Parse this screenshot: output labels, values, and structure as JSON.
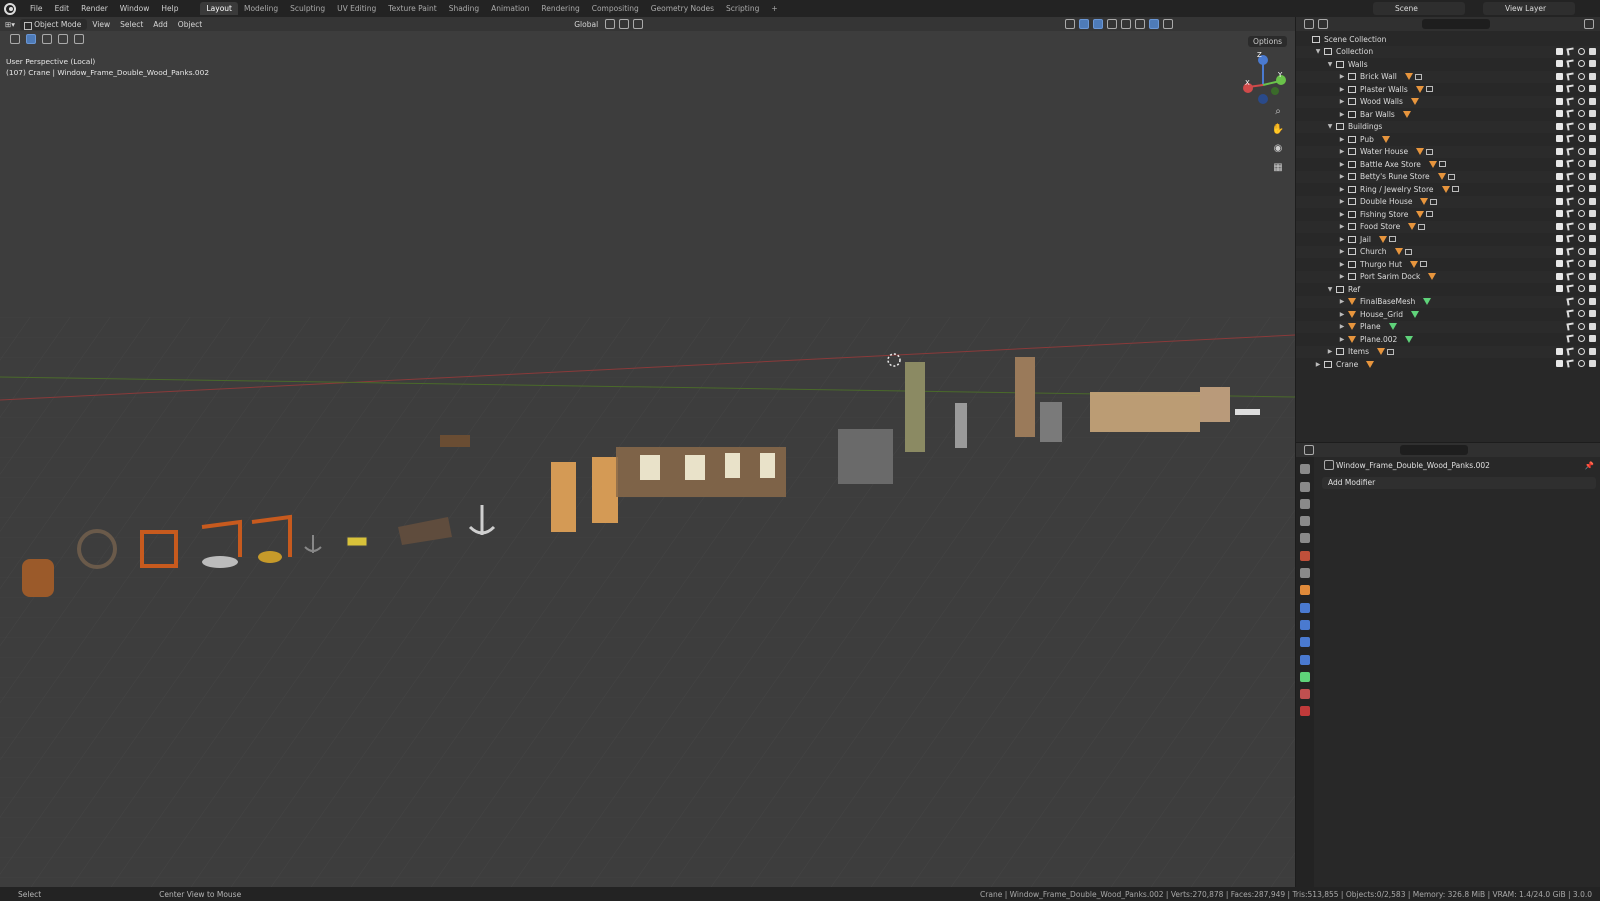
{
  "menu": [
    "File",
    "Edit",
    "Render",
    "Window",
    "Help"
  ],
  "workspaces": [
    "Layout",
    "Modeling",
    "Sculpting",
    "UV Editing",
    "Texture Paint",
    "Shading",
    "Animation",
    "Rendering",
    "Compositing",
    "Geometry Nodes",
    "Scripting",
    "+"
  ],
  "active_workspace": "Layout",
  "scene": "Scene",
  "view_layer": "View Layer",
  "viewport": {
    "mode": "Object Mode",
    "menus": [
      "View",
      "Select",
      "Add",
      "Object"
    ],
    "orientation": "Global",
    "options": "Options",
    "info_line1": "User Perspective (Local)",
    "info_line2": "(107) Crane | Window_Frame_Double_Wood_Panks.002",
    "gizmo": {
      "z": "Z",
      "y": "Y",
      "x": "X"
    }
  },
  "outliner": {
    "items": [
      {
        "label": "Scene Collection",
        "depth": 0,
        "type": "scene"
      },
      {
        "label": "Collection",
        "depth": 1,
        "type": "collection",
        "open": true
      },
      {
        "label": "Walls",
        "depth": 2,
        "type": "collection",
        "open": true
      },
      {
        "label": "Brick Wall",
        "depth": 3,
        "type": "collection",
        "tags": "mixed"
      },
      {
        "label": "Plaster Walls",
        "depth": 3,
        "type": "collection",
        "tags": "mixed"
      },
      {
        "label": "Wood Walls",
        "depth": 3,
        "type": "collection",
        "tags": "mesh"
      },
      {
        "label": "Bar Walls",
        "depth": 3,
        "type": "collection",
        "tags": "mesh"
      },
      {
        "label": "Buildings",
        "depth": 2,
        "type": "collection",
        "open": true
      },
      {
        "label": "Pub",
        "depth": 3,
        "type": "collection",
        "tags": "mesh"
      },
      {
        "label": "Water House",
        "depth": 3,
        "type": "collection",
        "tags": "mixed"
      },
      {
        "label": "Battle Axe Store",
        "depth": 3,
        "type": "collection",
        "tags": "mixed"
      },
      {
        "label": "Betty's Rune Store",
        "depth": 3,
        "type": "collection",
        "tags": "mixed"
      },
      {
        "label": "Ring / Jewelry Store",
        "depth": 3,
        "type": "collection",
        "tags": "mixed"
      },
      {
        "label": "Double House",
        "depth": 3,
        "type": "collection",
        "tags": "mixed"
      },
      {
        "label": "Fishing Store",
        "depth": 3,
        "type": "collection",
        "tags": "mixed"
      },
      {
        "label": "Food Store",
        "depth": 3,
        "type": "collection",
        "tags": "mixed"
      },
      {
        "label": "Jail",
        "depth": 3,
        "type": "collection",
        "tags": "mixed"
      },
      {
        "label": "Church",
        "depth": 3,
        "type": "collection",
        "tags": "mixed"
      },
      {
        "label": "Thurgo Hut",
        "depth": 3,
        "type": "collection",
        "tags": "mixed"
      },
      {
        "label": "Port Sarim Dock",
        "depth": 3,
        "type": "collection",
        "tags": "mesh"
      },
      {
        "label": "Ref",
        "depth": 2,
        "type": "collection",
        "open": true
      },
      {
        "label": "FinalBaseMesh",
        "depth": 3,
        "type": "mesh",
        "tags": "green"
      },
      {
        "label": "House_Grid",
        "depth": 3,
        "type": "mesh",
        "tags": "green"
      },
      {
        "label": "Plane",
        "depth": 3,
        "type": "mesh",
        "tags": "green"
      },
      {
        "label": "Plane.002",
        "depth": 3,
        "type": "mesh",
        "tags": "green"
      },
      {
        "label": "Items",
        "depth": 2,
        "type": "collection",
        "tags": "mixed"
      },
      {
        "label": "Crane",
        "depth": 1,
        "type": "collection",
        "tags": "mesh"
      }
    ]
  },
  "properties": {
    "object_name": "Window_Frame_Double_Wood_Panks.002",
    "add_modifier": "Add Modifier"
  },
  "status": {
    "select": "Select",
    "center": "Center View to Mouse",
    "stats": "Crane | Window_Frame_Double_Wood_Panks.002 | Verts:270,878 | Faces:287,949 | Tris:513,855 | Objects:0/2,583 | Memory: 326.8 MiB | VRAM: 1.4/24.0 GiB | 3.0.0"
  }
}
